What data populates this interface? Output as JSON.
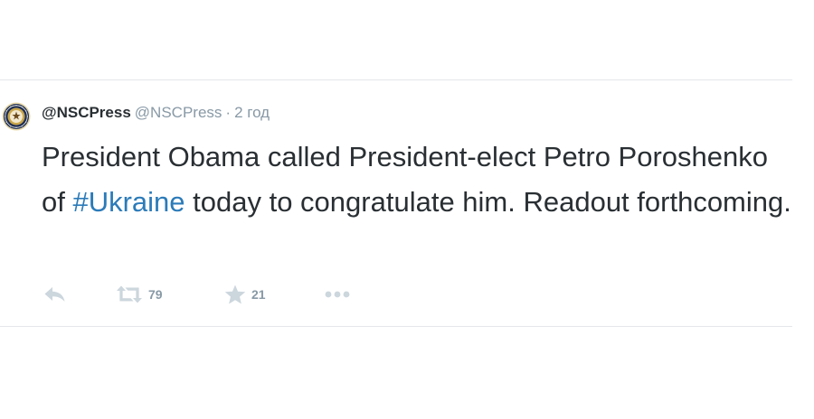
{
  "tweet": {
    "display_name": "@NSCPress",
    "handle": "@NSCPress",
    "separator": "·",
    "time": "2 год",
    "text_before": "President Obama called President-elect Petro Poroshenko of ",
    "hashtag": "#Ukraine",
    "text_after": " today to congratulate him. Readout forthcoming.",
    "avatar_icon": "presidential-seal-icon",
    "link_color": "#2b7bb9"
  },
  "actions": {
    "reply_icon": "reply-icon",
    "retweet_icon": "retweet-icon",
    "retweet_count": "79",
    "favorite_icon": "star-icon",
    "favorite_count": "21",
    "more_icon": "more-dots-icon"
  }
}
